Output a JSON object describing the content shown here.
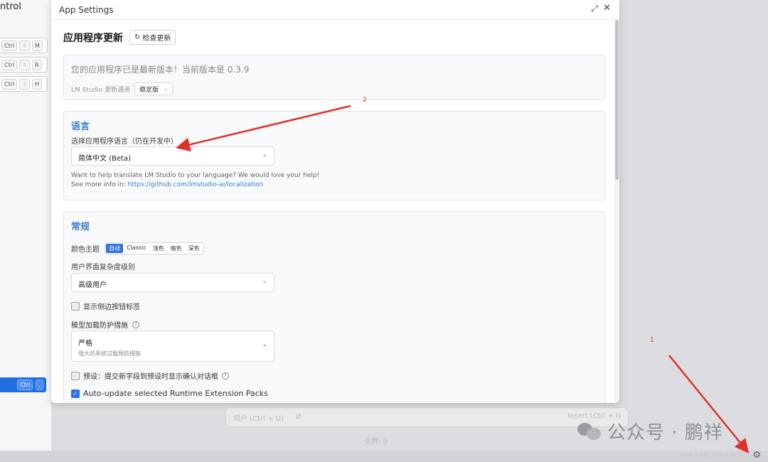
{
  "background": {
    "left_title": "ntrol",
    "shortcuts": [
      {
        "keys": [
          "Ctrl",
          "⇧",
          "M"
        ]
      },
      {
        "keys": [
          "Ctrl",
          "⇧",
          "R"
        ]
      },
      {
        "keys": [
          "Ctrl",
          "⇧",
          "H"
        ]
      }
    ],
    "active_shortcut": {
      "keys": [
        "Ctrl",
        ","
      ]
    },
    "input_placeholder": "用户 (Ctrl + U)",
    "insert_label": "Insert (Ctrl + I)",
    "token_count": "令牌: 0",
    "status_text": "RAM: 0 GB | CPU: 0.00 %",
    "watermark": "公众号 · 鹏祥"
  },
  "dialog": {
    "title": "App Settings",
    "update": {
      "heading": "应用程序更新",
      "check_button": "检查更新",
      "latest_text": "您的应用程序已是最新版本！当前版本是 0.3.9",
      "channel_label": "LM Studio 更新通道",
      "channel_value": "稳定版"
    },
    "language": {
      "title": "语言",
      "label": "选择应用程序语言（仍在开发中）",
      "value": "简体中文 (Beta)",
      "help_line1": "Want to help translate LM Studio to your language? We would love your help!",
      "help_prefix": "See more info in: ",
      "help_link": "https://github.com/lmstudio-ai/localization"
    },
    "general": {
      "title": "常规",
      "theme_label": "颜色主题",
      "themes": [
        "自动",
        "Classic",
        "浅色",
        "暗色",
        "深色"
      ],
      "complexity_label": "用户界面复杂度级别",
      "complexity_value": "高级用户",
      "sidebar_labels": "显示侧边按钮标签",
      "guard_label": "模型加载防护措施",
      "guard_value": "严格",
      "guard_sub": "强大的系统过载预防措施",
      "preset_confirm": "预设：提交新字段到预设时显示确认对话框",
      "auto_update": "Auto-update selected Runtime Extension Packs"
    }
  },
  "annotations": {
    "arrow1": "1",
    "arrow2": "2",
    "color": "#e0302c"
  }
}
